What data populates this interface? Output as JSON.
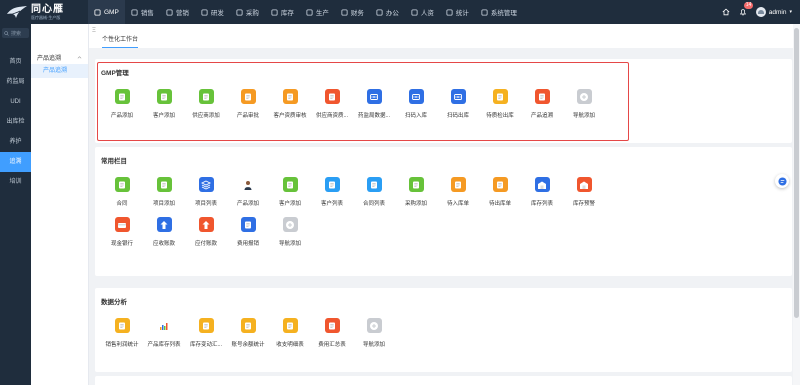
{
  "app": {
    "name": "同心雁",
    "tagline": "医疗器械·生产版"
  },
  "top_nav": [
    {
      "label": "GMP",
      "icon": "gmp-icon",
      "active": true
    },
    {
      "label": "销售",
      "icon": "sales-icon"
    },
    {
      "label": "营销",
      "icon": "marketing-icon"
    },
    {
      "label": "研发",
      "icon": "rd-icon"
    },
    {
      "label": "采购",
      "icon": "purchase-icon"
    },
    {
      "label": "库存",
      "icon": "inventory-icon"
    },
    {
      "label": "生产",
      "icon": "production-icon"
    },
    {
      "label": "财务",
      "icon": "finance-icon"
    },
    {
      "label": "办公",
      "icon": "office-icon"
    },
    {
      "label": "人资",
      "icon": "hr-icon"
    },
    {
      "label": "统计",
      "icon": "stats-icon"
    },
    {
      "label": "系统管理",
      "icon": "system-icon"
    }
  ],
  "header_right": {
    "notification_count": "14",
    "username": "admin"
  },
  "sidebar": {
    "search_placeholder": "搜索",
    "items": [
      {
        "label": "首页"
      },
      {
        "label": "药监局"
      },
      {
        "label": "UDI"
      },
      {
        "label": "出库检"
      },
      {
        "label": "养护"
      },
      {
        "label": "追溯",
        "active": true
      },
      {
        "label": "培训"
      }
    ]
  },
  "subsidebar": {
    "group": "产品追溯",
    "item": "产品追溯"
  },
  "tabs": [
    {
      "label": "个性化工作台",
      "active": true
    }
  ],
  "sections": [
    {
      "title": "GMP管理",
      "apps": [
        {
          "label": "产品添加",
          "icon": "add-product-icon",
          "color": "#67c23a"
        },
        {
          "label": "客户添加",
          "icon": "add-customer-icon",
          "color": "#67c23a"
        },
        {
          "label": "供应商添加",
          "icon": "add-supplier-icon",
          "color": "#67c23a"
        },
        {
          "label": "产品审批",
          "icon": "product-approval-icon",
          "color": "#f59a23"
        },
        {
          "label": "客户资质审核",
          "icon": "customer-audit-icon",
          "color": "#f59a23"
        },
        {
          "label": "供应商资质...",
          "icon": "supplier-qualification-icon",
          "color": "#f0562e"
        },
        {
          "label": "药监局数据...",
          "icon": "fda-data-icon",
          "color": "#2f6fe4"
        },
        {
          "label": "扫码入库",
          "icon": "scan-in-icon",
          "color": "#2f6fe4"
        },
        {
          "label": "扫码出库",
          "icon": "scan-out-icon",
          "color": "#2f6fe4"
        },
        {
          "label": "待质检出库",
          "icon": "pending-qc-icon",
          "color": "#f5b120"
        },
        {
          "label": "产品追溯",
          "icon": "trace-icon",
          "color": "#f0562e"
        },
        {
          "label": "导航添加",
          "icon": "plus-icon",
          "color": "#c9ccd1"
        }
      ]
    },
    {
      "title": "常用栏目",
      "apps": [
        {
          "label": "合同",
          "icon": "contract-icon",
          "color": "#67c23a"
        },
        {
          "label": "项目添加",
          "icon": "add-project-icon",
          "color": "#67c23a"
        },
        {
          "label": "项目列表",
          "icon": "project-list-icon",
          "color": "#2f6fe4"
        },
        {
          "label": "产品添加",
          "icon": "person-avatar-icon",
          "color": "#ffffff"
        },
        {
          "label": "客户添加",
          "icon": "add-customer-icon",
          "color": "#67c23a"
        },
        {
          "label": "客户列表",
          "icon": "customer-list-icon",
          "color": "#2a9ef4"
        },
        {
          "label": "合同列表",
          "icon": "contract-list-icon",
          "color": "#2a9ef4"
        },
        {
          "label": "采购添加",
          "icon": "add-purchase-icon",
          "color": "#67c23a"
        },
        {
          "label": "待入库单",
          "icon": "pending-in-icon",
          "color": "#f59a23"
        },
        {
          "label": "待出库单",
          "icon": "pending-out-icon",
          "color": "#f59a23"
        },
        {
          "label": "库存列表",
          "icon": "stock-list-icon",
          "color": "#2f6fe4"
        },
        {
          "label": "库存预警",
          "icon": "stock-alert-icon",
          "color": "#f0562e"
        },
        {
          "label": "现金银行",
          "icon": "cash-bank-icon",
          "color": "#f0562e"
        },
        {
          "label": "应收账款",
          "icon": "receivable-icon",
          "color": "#2f6fe4"
        },
        {
          "label": "应付账款",
          "icon": "payable-icon",
          "color": "#f0562e"
        },
        {
          "label": "费用报销",
          "icon": "expense-icon",
          "color": "#2f6fe4"
        },
        {
          "label": "导航添加",
          "icon": "plus-icon",
          "color": "#c9ccd1"
        }
      ]
    },
    {
      "title": "数据分析",
      "apps": [
        {
          "label": "销售利润统计",
          "icon": "profit-stats-icon",
          "color": "#f5b120"
        },
        {
          "label": "产品库存列表",
          "icon": "bar-chart-icon",
          "color": "#ffffff"
        },
        {
          "label": "库存变动汇...",
          "icon": "stock-change-icon",
          "color": "#f5b120"
        },
        {
          "label": "账号余额统计",
          "icon": "balance-icon",
          "color": "#f5b120"
        },
        {
          "label": "收支明细表",
          "icon": "income-expense-icon",
          "color": "#f5b120"
        },
        {
          "label": "费用汇总表",
          "icon": "expense-summary-icon",
          "color": "#f0562e"
        },
        {
          "label": "导航添加",
          "icon": "plus-icon",
          "color": "#c9ccd1"
        }
      ]
    }
  ]
}
